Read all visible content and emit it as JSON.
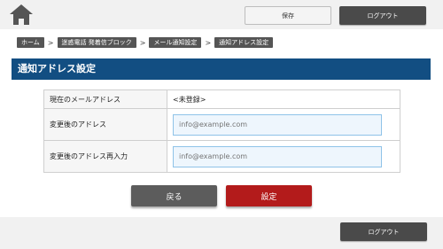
{
  "header": {
    "home_icon": "home-icon",
    "save_label": "保存",
    "logout_label": "ログアウト"
  },
  "breadcrumb": [
    "ホーム",
    "迷惑電話 発着信ブロック",
    "メール通知設定",
    "通知アドレス設定"
  ],
  "page": {
    "title": "通知アドレス設定"
  },
  "form": {
    "current_label": "現在のメールアドレス",
    "current_value": "<未登録>",
    "new_label": "変更後のアドレス",
    "new_placeholder": "info@example.com",
    "confirm_label": "変更後のアドレス再入力",
    "confirm_placeholder": "info@example.com"
  },
  "actions": {
    "back_label": "戻る",
    "submit_label": "設定"
  },
  "footer": {
    "logout_label": "ログアウト"
  },
  "colors": {
    "title_bar": "#124e82",
    "submit_button": "#b31b1b",
    "dark_button": "#4a4a4a"
  }
}
